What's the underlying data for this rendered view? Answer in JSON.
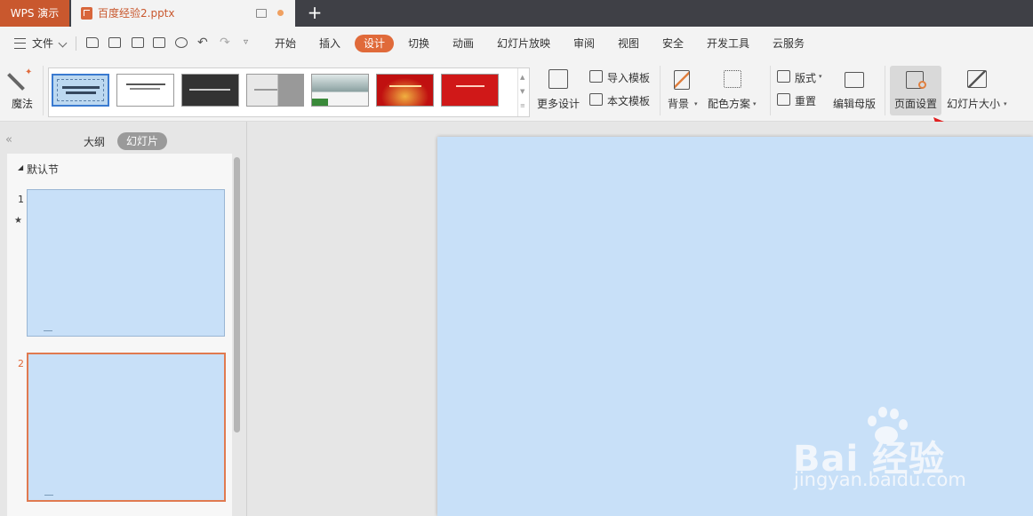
{
  "titlebar": {
    "app_tab": "WPS 演示",
    "doc_title": "百度经验2.pptx",
    "new_tab": "+"
  },
  "menubar": {
    "file": "文件",
    "tabs": [
      "开始",
      "插入",
      "设计",
      "切换",
      "动画",
      "幻灯片放映",
      "审阅",
      "视图",
      "安全",
      "开发工具",
      "云服务"
    ],
    "active_tab": "设计"
  },
  "ribbon": {
    "magic": "魔法",
    "more_design": "更多设计",
    "import_template": "导入模板",
    "text_template": "本文模板",
    "background": "背景",
    "color_scheme": "配色方案",
    "layout": "版式",
    "reset": "重置",
    "edit_master": "编辑母版",
    "page_setup": "页面设置",
    "slide_size": "幻灯片大小"
  },
  "left_panel": {
    "collapse": "«",
    "outline_tab": "大纲",
    "slides_tab": "幻灯片",
    "section": "默认节",
    "slides": [
      {
        "number": "1"
      },
      {
        "number": "2"
      }
    ]
  },
  "watermark": {
    "logo": "Bai 经验",
    "url": "jingyan.baidu.com"
  },
  "colors": {
    "accent": "#e06a3a",
    "slide_bg": "#c8e0f8",
    "titlebar": "#3f4046"
  }
}
